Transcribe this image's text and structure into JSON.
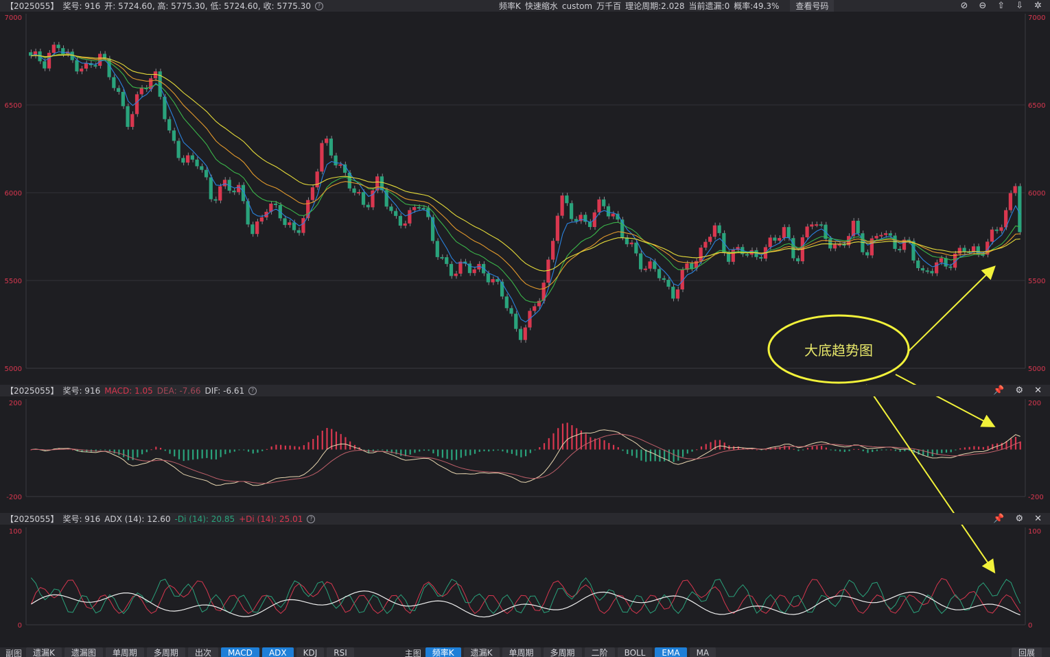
{
  "header": {
    "code": "【2025055】",
    "prize": "奖号: 916",
    "ohlc": "开: 5724.60, 高: 5775.30, 低: 5724.60, 收: 5775.30",
    "tools": [
      "频率K",
      "快速缩水",
      "custom",
      "万千百",
      "理论周期:2.028",
      "当前遗漏:0",
      "概率:49.3%"
    ],
    "view_button": "查看号码"
  },
  "macd_header": {
    "code": "【2025055】",
    "prize": "奖号: 916",
    "macd": "MACD: 1.05",
    "dea": "DEA: -7.66",
    "dif": "DIF: -6.61"
  },
  "adx_header": {
    "code": "【2025055】",
    "prize": "奖号: 916",
    "adx": "ADX (14): 12.60",
    "mdi": "-Di (14): 20.85",
    "pdi": "+Di (14): 25.01"
  },
  "bottom": {
    "sub_label": "副图",
    "sub_buttons": [
      "遗漏K",
      "遗漏图",
      "单周期",
      "多周期",
      "出次",
      "MACD",
      "ADX",
      "KDJ",
      "RSI"
    ],
    "sub_active": [
      "MACD",
      "ADX"
    ],
    "main_label": "主图",
    "main_buttons": [
      "频率K",
      "遗漏K",
      "单周期",
      "多周期",
      "二阶",
      "BOLL",
      "EMA",
      "MA"
    ],
    "main_active": [
      "频率K",
      "EMA"
    ],
    "right_button": "回展"
  },
  "annotation": "大底趋势图",
  "colors": {
    "up": "#d9374f",
    "down": "#2aa37c",
    "ema1": "#2a83e0",
    "ema2": "#3bb54a",
    "ema3": "#e39a2c",
    "ema4": "#e6dc3a",
    "arrow": "#f2f23a"
  },
  "chart_data": [
    {
      "type": "candlestick",
      "ylim": [
        5000,
        7000
      ],
      "yticks": [
        5000,
        5500,
        6000,
        6500,
        7000
      ],
      "close_path": [
        6780,
        6720,
        6850,
        6760,
        6700,
        6760,
        6620,
        6420,
        6600,
        6640,
        6320,
        6200,
        6180,
        5940,
        6060,
        6030,
        5740,
        5920,
        5880,
        5780,
        5930,
        6290,
        6180,
        6060,
        5900,
        6060,
        5860,
        5860,
        5950,
        5680,
        5560,
        5600,
        5550,
        5500,
        5430,
        5180,
        5300,
        5500,
        6000,
        5870,
        5800,
        5940,
        5860,
        5710,
        5550,
        5560,
        5420,
        5580,
        5610,
        5820,
        5650,
        5690,
        5600,
        5700,
        5820,
        5610,
        5840,
        5750,
        5690,
        5820,
        5620,
        5800,
        5720,
        5710,
        5500,
        5600,
        5620,
        5690,
        5620,
        5760,
        5900,
        6150
      ],
      "ema_lines": [
        {
          "name": "",
          "start": 6900,
          "end": 5900
        },
        {
          "name": "",
          "start": 6810,
          "end": 5770
        },
        {
          "name": "",
          "start": 6750,
          "end": 5740
        },
        {
          "name": "",
          "start": 6780,
          "end": 5730
        }
      ],
      "last": {
        "open": 5724.6,
        "high": 5775.3,
        "low": 5724.6,
        "close": 5775.3
      }
    },
    {
      "type": "macd",
      "ylim": [
        -200,
        200
      ],
      "yticks": [
        -200,
        200
      ],
      "last": {
        "macd": 1.05,
        "dea": -7.66,
        "dif": -6.61
      }
    },
    {
      "type": "adx",
      "ylim": [
        0,
        100
      ],
      "yticks": [
        0,
        100
      ],
      "last": {
        "adx": 12.6,
        "mdi": 20.85,
        "pdi": 25.01
      }
    }
  ]
}
